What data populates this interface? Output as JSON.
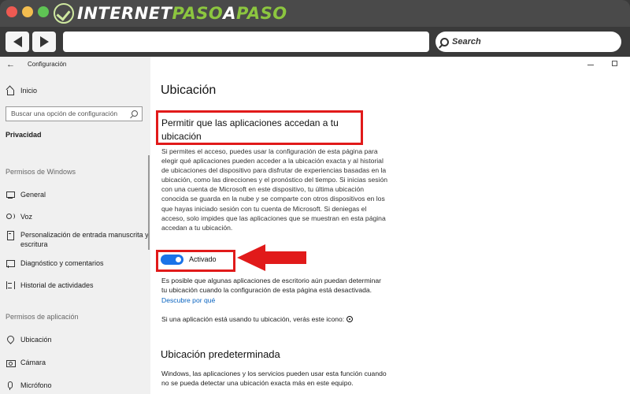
{
  "browser": {
    "logo": {
      "part1": "INTERNET",
      "part2": "PASO",
      "part3": "A",
      "part4": "PASO"
    },
    "search_placeholder": "Search"
  },
  "sidebar": {
    "app_title": "Configuración",
    "home": "Inicio",
    "search_placeholder": "Buscar una opción de configuración",
    "section": "Privacidad",
    "group_windows": "Permisos de Windows",
    "windows_items": [
      {
        "label": "General",
        "icon": "monitor-icon"
      },
      {
        "label": "Voz",
        "icon": "voice-icon"
      },
      {
        "label": "Personalización de entrada manuscrita y escritura",
        "icon": "pen-icon"
      },
      {
        "label": "Diagnóstico y comentarios",
        "icon": "diagnostics-icon"
      },
      {
        "label": "Historial de actividades",
        "icon": "history-icon"
      }
    ],
    "group_apps": "Permisos de aplicación",
    "app_items": [
      {
        "label": "Ubicación",
        "icon": "location-icon"
      },
      {
        "label": "Cámara",
        "icon": "camera-icon"
      },
      {
        "label": "Micrófono",
        "icon": "microphone-icon"
      }
    ]
  },
  "main": {
    "title": "Ubicación",
    "heading": "Permitir que las aplicaciones accedan a tu ubicación",
    "description": "Si permites el acceso, puedes usar la configuración de esta página para elegir qué aplicaciones pueden acceder a la ubicación exacta y al historial de ubicaciones del dispositivo para disfrutar de experiencias basadas en la ubicación, como las direcciones y el pronóstico del tiempo. Si inicias sesión con una cuenta de Microsoft en este dispositivo, tu última ubicación conocida se guarda en la nube y se comparte con otros dispositivos en los que hayas iniciado sesión con tu cuenta de Microsoft. Si deniegas el acceso, solo impides que las aplicaciones que se muestran en esta página accedan a tu ubicación.",
    "toggle_label": "Activado",
    "toggle_on": true,
    "note": "Es posible que algunas aplicaciones de escritorio aún puedan determinar tu ubicación cuando la configuración de esta página está desactivada.",
    "note_link": "Descubre por qué",
    "indicator_text": "Si una aplicación está usando tu ubicación, verás este icono:",
    "sub_heading": "Ubicación predeterminada",
    "sub_description": "Windows, las aplicaciones y los servicios pueden usar esta función cuando no se pueda detectar una ubicación exacta más en este equipo."
  },
  "colors": {
    "highlight_red": "#e11a1a",
    "toggle_blue": "#1a73e8",
    "link_blue": "#0a64c0",
    "logo_green": "#8cc63f"
  }
}
